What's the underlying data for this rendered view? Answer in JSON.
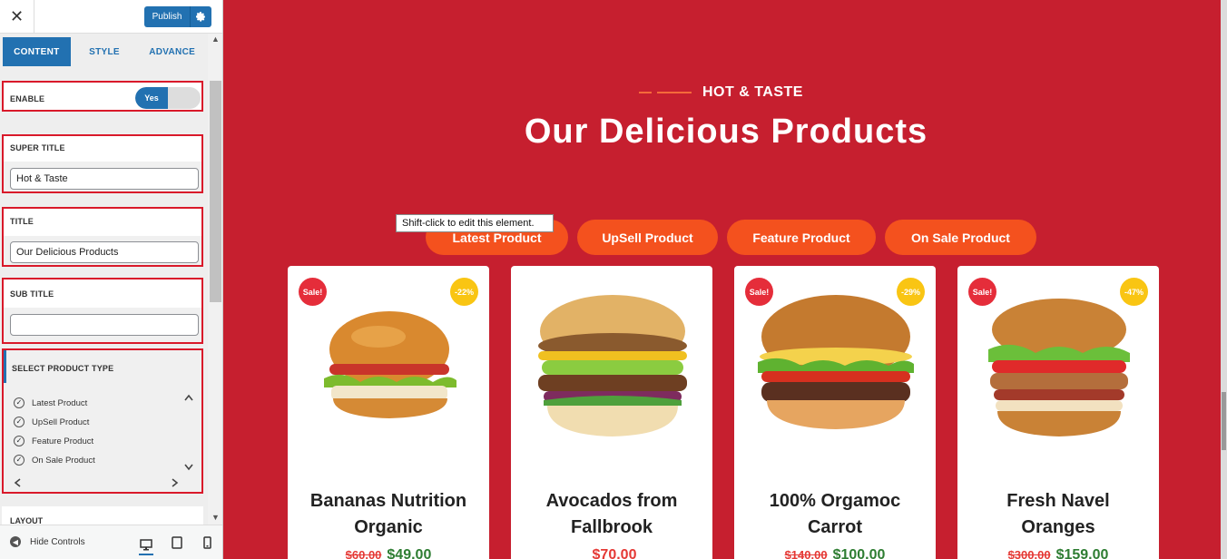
{
  "panel": {
    "publish_label": "Publish",
    "tabs": [
      {
        "label": "CONTENT"
      },
      {
        "label": "STYLE"
      },
      {
        "label": "ADVANCE"
      }
    ],
    "enable": {
      "label": "ENABLE",
      "toggle_value": "Yes"
    },
    "super_title": {
      "label": "SUPER TITLE",
      "value": "Hot & Taste"
    },
    "title": {
      "label": "TITLE",
      "value": "Our Delicious Products"
    },
    "sub_title": {
      "label": "SUB TITLE",
      "value": ""
    },
    "product_type": {
      "label": "SELECT PRODUCT TYPE",
      "options": [
        {
          "label": "Latest Product",
          "checked": true
        },
        {
          "label": "UpSell Product",
          "checked": true
        },
        {
          "label": "Feature Product",
          "checked": true
        },
        {
          "label": "On Sale Product",
          "checked": true
        }
      ]
    },
    "layout_label": "LAYOUT",
    "hide_controls_label": "Hide Controls"
  },
  "preview": {
    "super_title": "HOT & TASTE",
    "title": "Our Delicious Products",
    "tooltip": "Shift-click to edit this element.",
    "filters": [
      {
        "label": "Latest Product"
      },
      {
        "label": "UpSell Product"
      },
      {
        "label": "Feature Product"
      },
      {
        "label": "On Sale Product"
      }
    ],
    "products": [
      {
        "name_line1": "Bananas Nutrition",
        "name_line2": "Organic",
        "sale": "Sale!",
        "discount": "-22%",
        "old_price": "$60.00",
        "new_price": "$49.00"
      },
      {
        "name_line1": "Avocados from",
        "name_line2": "Fallbrook",
        "sale": "",
        "discount": "",
        "old_price": "",
        "new_price": "$70.00"
      },
      {
        "name_line1": "100% Orgamoc",
        "name_line2": "Carrot",
        "sale": "Sale!",
        "discount": "-29%",
        "old_price": "$140.00",
        "new_price": "$100.00"
      },
      {
        "name_line1": "Fresh Navel",
        "name_line2": "Oranges",
        "sale": "Sale!",
        "discount": "-47%",
        "old_price": "$300.00",
        "new_price": "$159.00"
      }
    ]
  },
  "colors": {
    "accent": "#2271b1",
    "highlight_border": "#d9192a",
    "preview_bg": "#c61f2f",
    "filter_bg": "#f4511e",
    "sale_badge": "#e52d3a",
    "discount_badge": "#f9c513",
    "new_price": "#2e7d32"
  },
  "icons": [
    "close-icon",
    "gear-icon",
    "chevron-up-icon",
    "chevron-down-icon",
    "arrow-left-icon",
    "arrow-right-icon",
    "hide-controls-icon",
    "desktop-icon",
    "tablet-icon",
    "mobile-icon",
    "checkmark-icon"
  ]
}
